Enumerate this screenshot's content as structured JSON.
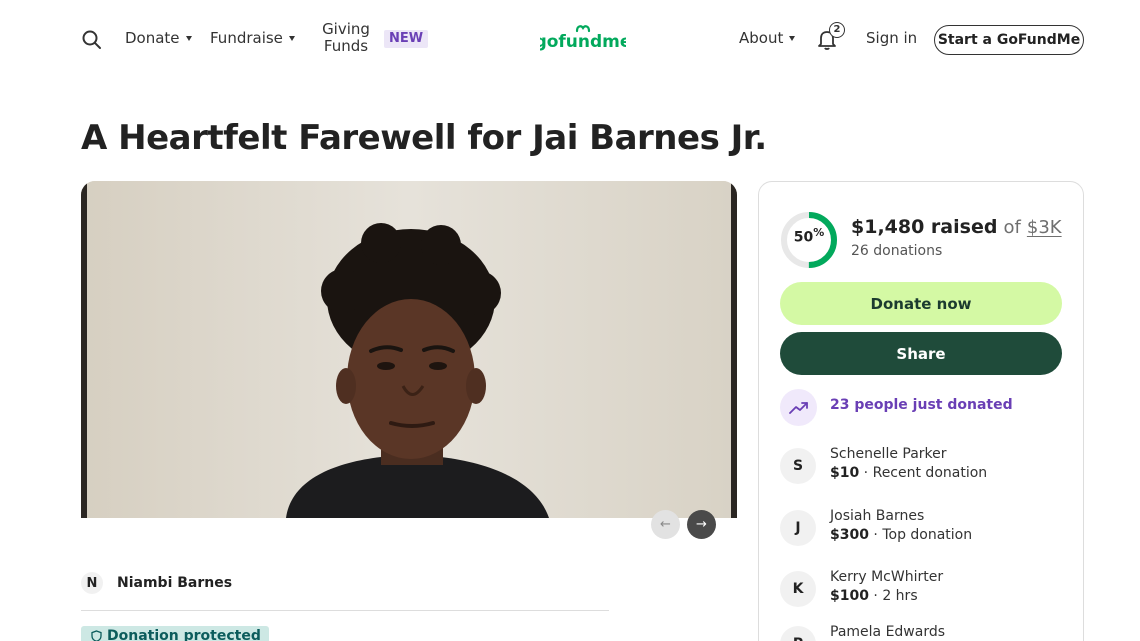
{
  "header": {
    "nav": {
      "donate": "Donate",
      "fundraise": "Fundraise",
      "giving_funds_line1": "Giving",
      "giving_funds_line2": "Funds",
      "new_badge": "NEW",
      "about": "About",
      "notification_count": "2",
      "sign_in": "Sign in",
      "start_button": "Start a GoFundMe"
    },
    "logo_text": "gofundme"
  },
  "campaign": {
    "title": "A Heartfelt Farewell for Jai Barnes Jr.",
    "organizer_initial": "N",
    "organizer_name": "Niambi Barnes",
    "protected_label": "Donation protected"
  },
  "progress": {
    "percent": 50,
    "percent_label": "50",
    "percent_sign": "%",
    "raised_amount": "$1,480 raised",
    "of_text": "of",
    "goal": "$3K",
    "donations": "26 donations"
  },
  "actions": {
    "donate_label": "Donate now",
    "share_label": "Share"
  },
  "activity": {
    "trend_text": "23 people just donated"
  },
  "donors": [
    {
      "initial": "S",
      "name": "Schenelle Parker",
      "amount": "$10",
      "note": "Recent donation"
    },
    {
      "initial": "J",
      "name": "Josiah Barnes",
      "amount": "$300",
      "note": "Top donation"
    },
    {
      "initial": "K",
      "name": "Kerry McWhirter",
      "amount": "$100",
      "note": "2 hrs"
    },
    {
      "initial": "P",
      "name": "Pamela Edwards",
      "amount": "",
      "note": ""
    }
  ],
  "colors": {
    "brand_green": "#02a95c",
    "donate_button": "#d4f9a4",
    "share_button": "#1f4b3a",
    "accent_purple": "#6a3fb5",
    "protected_bg": "#cde8e4"
  },
  "icons": {
    "search": "search-icon",
    "bell": "bell-icon",
    "trend": "trending-up-icon",
    "shield": "shield-icon",
    "arrow_left": "arrow-left-icon",
    "arrow_right": "arrow-right-icon"
  }
}
